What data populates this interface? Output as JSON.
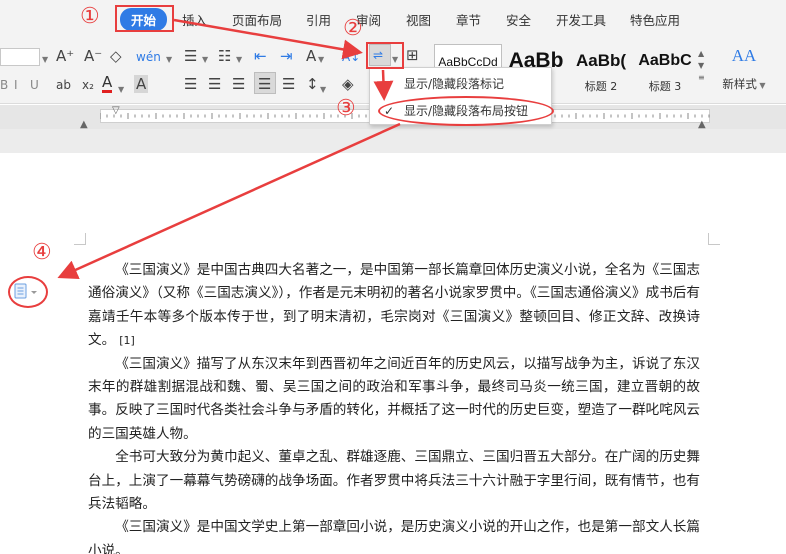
{
  "tabs": [
    {
      "label": "开始",
      "active": true
    },
    {
      "label": "插入"
    },
    {
      "label": "页面布局"
    },
    {
      "label": "引用"
    },
    {
      "label": "审阅"
    },
    {
      "label": "视图"
    },
    {
      "label": "章节"
    },
    {
      "label": "安全"
    },
    {
      "label": "开发工具"
    },
    {
      "label": "特色应用"
    }
  ],
  "toolbar": {
    "font_grow": "A⁺",
    "font_shrink": "A⁻",
    "eraser": "◇",
    "pinyin": "wén",
    "strike": "ab",
    "subscript": "x₂",
    "font_color": "A",
    "char_shade": "A",
    "text_direction": "A",
    "sort": "A↕",
    "paragraph_mark_label": "⇌"
  },
  "styles": [
    {
      "sample": "AaBbCcDd",
      "label": ""
    },
    {
      "sample": "AaBb",
      "label": ""
    },
    {
      "sample": "AaBb(",
      "label": "标题 2"
    },
    {
      "sample": "AaBbC",
      "label": "标题 3"
    }
  ],
  "new_style": {
    "label": "新样式",
    "icon": "AA"
  },
  "menu": {
    "items": [
      {
        "label": "显示/隐藏段落标记",
        "checked": false
      },
      {
        "label": "显示/隐藏段落布局按钮",
        "checked": true
      }
    ]
  },
  "annotations": [
    "①",
    "②",
    "③",
    "④"
  ],
  "document": {
    "paragraphs": [
      "《三国演义》是中国古典四大名著之一，是中国第一部长篇章回体历史演义小说，全名为《三国志通俗演义》（又称《三国志演义》），作者是元末明初的著名小说家罗贯中。《三国志通俗演义》成书后有嘉靖壬午本等多个版本传于世，到了明末清初，毛宗岗对《三国演义》整顿回目、修正文辞、改换诗文。",
      "《三国演义》描写了从东汉末年到西晋初年之间近百年的历史风云，以描写战争为主，诉说了东汉末年的群雄割据混战和魏、蜀、吴三国之间的政治和军事斗争，最终司马炎一统三国，建立晋朝的故事。反映了三国时代各类社会斗争与矛盾的转化，并概括了这一时代的历史巨变，塑造了一群叱咤风云的三国英雄人物。",
      "全书可大致分为黄巾起义、董卓之乱、群雄逐鹿、三国鼎立、三国归晋五大部分。在广阔的历史舞台上，上演了一幕幕气势磅礴的战争场面。作者罗贯中将兵法三十六计融于字里行间，既有情节，也有兵法韬略。",
      "《三国演义》是中国文学史上第一部章回小说，是历史演义小说的开山之作，也是第一部文人长篇小说。"
    ],
    "ref_mark": "[1]"
  },
  "colors": {
    "accent": "#2f7be5",
    "annotation": "#e83e3e"
  }
}
